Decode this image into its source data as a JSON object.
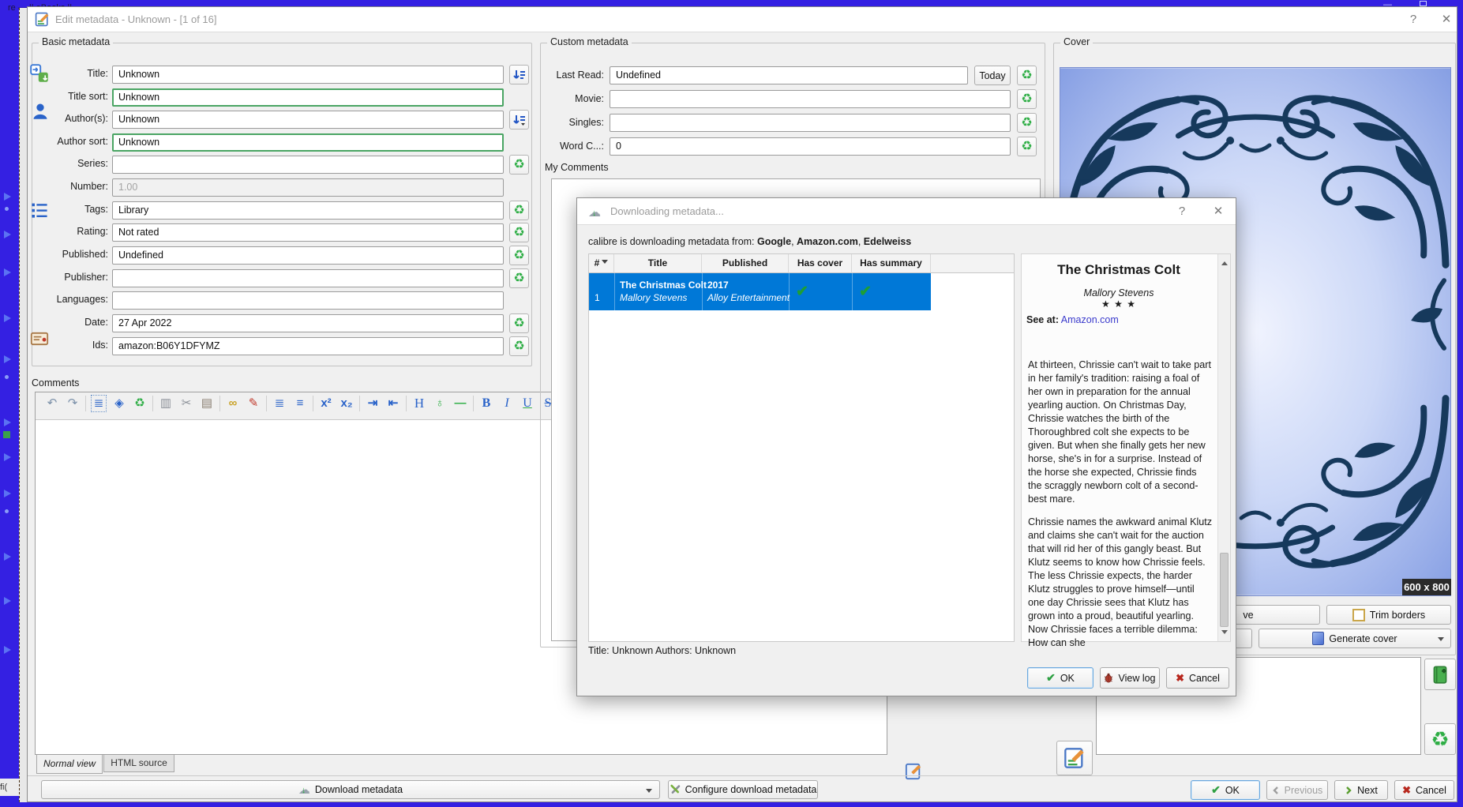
{
  "colors": {
    "selection_blue": "#0078d7",
    "changed_field_green": "#4aa563",
    "recycle_green": "#2fae46",
    "outer_border_blue": "#3420e2",
    "cover_navy": "#16395c",
    "link_blue": "#3a3acc"
  },
  "icons": {
    "cloud": "☁",
    "cloud_arrow": "↓",
    "check": "✔",
    "cross": "✖",
    "recycle": "♻",
    "help": "?",
    "close": "✕",
    "sort_arrow": "↓",
    "sort_lines": "≡",
    "minimize": "—",
    "stars": "★ ★ ★"
  },
  "background": {
    "top_title": "re — || eBooks ||",
    "bottom_left": "fi("
  },
  "window": {
    "title": "Edit metadata - Unknown -  [1 of 16]"
  },
  "basic": {
    "legend": "Basic metadata",
    "fields": [
      {
        "label": "Title:",
        "value": "Unknown"
      },
      {
        "label": "Title sort:",
        "value": "Unknown"
      },
      {
        "label": "Author(s):",
        "value": "Unknown"
      },
      {
        "label": "Author sort:",
        "value": "Unknown"
      },
      {
        "label": "Series:",
        "value": ""
      },
      {
        "label": "Number:",
        "value": "1.00"
      },
      {
        "label": "Tags:",
        "value": "Library"
      },
      {
        "label": "Rating:",
        "value": "Not rated"
      },
      {
        "label": "Published:",
        "value": "Undefined"
      },
      {
        "label": "Publisher:",
        "value": ""
      },
      {
        "label": "Languages:",
        "value": ""
      },
      {
        "label": "Date:",
        "value": "27 Apr 2022"
      },
      {
        "label": "Ids:",
        "value": "amazon:B06Y1DFYMZ"
      }
    ]
  },
  "comments": {
    "legend": "Comments",
    "tabs": [
      "Normal view",
      "HTML source"
    ],
    "toolbar": [
      {
        "name": "undo-icon",
        "glyph": "↶"
      },
      {
        "name": "redo-icon",
        "glyph": "↷"
      },
      {
        "name": "select-all-icon",
        "glyph": "≣"
      },
      {
        "name": "clear-formatting-icon",
        "glyph": "◈"
      },
      {
        "name": "remove-formatting-icon",
        "glyph": "♻"
      },
      {
        "name": "copy-icon",
        "glyph": "▥"
      },
      {
        "name": "cut-icon",
        "glyph": "✂"
      },
      {
        "name": "paste-icon",
        "glyph": "▤"
      },
      {
        "name": "insert-link-icon",
        "glyph": "∞"
      },
      {
        "name": "format-color-icon",
        "glyph": "✎"
      },
      {
        "name": "ordered-list-icon",
        "glyph": "≣"
      },
      {
        "name": "unordered-list-icon",
        "glyph": "≡"
      },
      {
        "name": "superscript-icon",
        "glyph": "x²"
      },
      {
        "name": "subscript-icon",
        "glyph": "x₂"
      },
      {
        "name": "indent-icon",
        "glyph": "⇥"
      },
      {
        "name": "outdent-icon",
        "glyph": "⇤"
      },
      {
        "name": "heading-icon",
        "glyph": "H"
      },
      {
        "name": "smarten-punctuation-icon",
        "glyph": "♁"
      },
      {
        "name": "horizontal-rule-icon",
        "glyph": "—"
      },
      {
        "name": "bold-icon",
        "glyph": "B"
      },
      {
        "name": "italic-icon",
        "glyph": "I"
      },
      {
        "name": "underline-icon",
        "glyph": "U"
      },
      {
        "name": "strikethrough-icon",
        "glyph": "S"
      }
    ]
  },
  "custom": {
    "legend": "Custom metadata",
    "fields": [
      {
        "label": "Last Read:",
        "value": "Undefined"
      },
      {
        "label": "Movie:",
        "value": ""
      },
      {
        "label": "Singles:",
        "value": ""
      },
      {
        "label": "Word C...:",
        "value": "0"
      }
    ],
    "today_button": "Today",
    "my_comments_label": "My Comments"
  },
  "cover": {
    "legend": "Cover",
    "size_badge": "600 x 800",
    "partial_button": "ve",
    "trim_button": "Trim borders",
    "generate_button": "Generate cover"
  },
  "dialog": {
    "title": "Downloading metadata...",
    "info_prefix": "calibre is downloading metadata from: ",
    "sources": [
      "Google",
      "Amazon.com",
      "Edelweiss"
    ],
    "sep": ", ",
    "table": {
      "headers": [
        "#",
        "Title",
        "Published",
        "Has cover",
        "Has summary"
      ],
      "row": {
        "index": "1",
        "title": "The Christmas Colt",
        "author": "Mallory Stevens",
        "year": "2017",
        "publisher": "Alloy Entertainment",
        "has_cover": "✔",
        "has_summary": "✔"
      }
    },
    "book": {
      "title": "The Christmas Colt",
      "author": "Mallory Stevens",
      "see_at": "See at:",
      "link": "Amazon.com",
      "p1": "At thirteen, Chrissie can't wait to take part in her family's tradition: raising a foal of her own in preparation for the annual yearling auction. On Christmas Day, Chrissie watches the birth of the Thoroughbred colt she expects to be given. But when she finally gets her new horse, she's in for a surprise. Instead of the horse she expected, Chrissie finds the scraggly newborn colt of a second-best mare.",
      "p2": "Chrissie names the awkward animal Klutz and claims she can't wait for the auction that will rid her of this gangly beast. But Klutz seems to know how Chrissie feels. The less Chrissie expects, the harder Klutz struggles to prove himself—until one day Chrissie sees that Klutz has grown into a proud, beautiful yearling. Now Chrissie faces a terrible dilemma: How can she"
    },
    "status": "Title: Unknown Authors: Unknown",
    "buttons": {
      "ok": "OK",
      "view_log": "View log",
      "cancel": "Cancel"
    }
  },
  "bottom": {
    "download": "Download metadata",
    "configure": "Configure download metadata",
    "ok": "OK",
    "previous": "Previous",
    "next": "Next",
    "cancel": "Cancel"
  }
}
